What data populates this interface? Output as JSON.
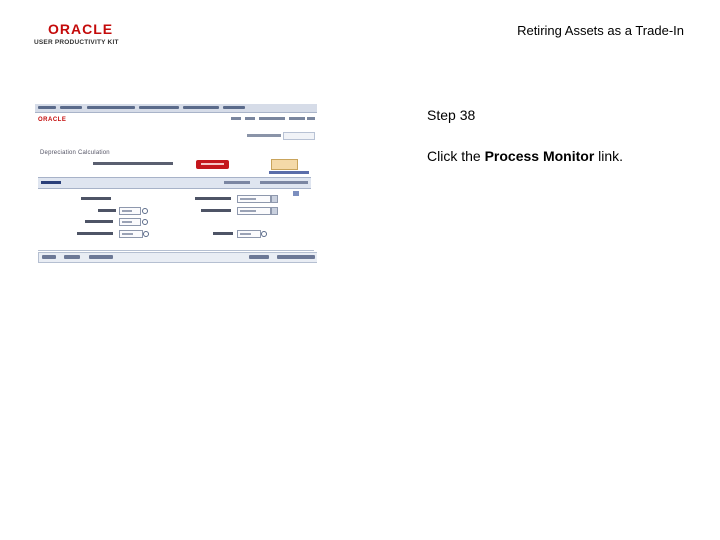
{
  "header": {
    "logo_brand": "ORACLE",
    "logo_product": "USER PRODUCTIVITY KIT",
    "document_title": "Retiring Assets as a Trade-In"
  },
  "step": {
    "label": "Step 38",
    "instruction_prefix": "Click the ",
    "instruction_target": "Process Monitor",
    "instruction_suffix": " link."
  },
  "screenshot": {
    "brand": "ORACLE",
    "page_title": "Depreciation Calculation"
  },
  "colors": {
    "oracle_red": "#c40a0a",
    "run_button": "#f4d9a8",
    "action_button_red": "#c4161c"
  }
}
